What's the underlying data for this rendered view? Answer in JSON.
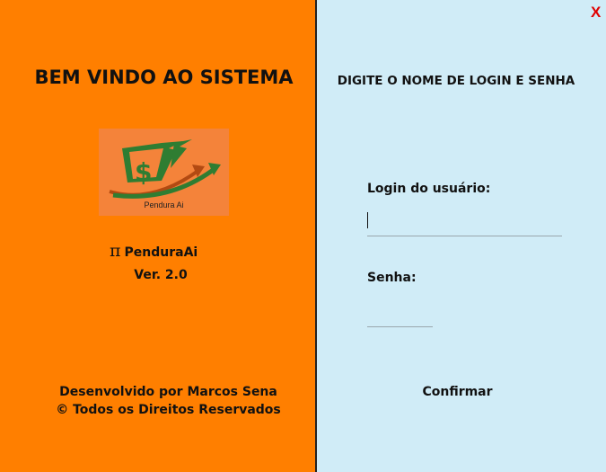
{
  "left_panel": {
    "welcome_title": "BEM VINDO AO SISTEMA",
    "logo_caption": "Pendura Ai",
    "pi_symbol": "π",
    "app_name": "PenduraAi",
    "version": "Ver. 2.0",
    "credits_line1": "Desenvolvido por Marcos Sena",
    "credits_line2": "© Todos os Direitos Reservados",
    "background_color": "#ff7f00"
  },
  "right_panel": {
    "close_label": "X",
    "instruction": "DIGITE O NOME DE LOGIN E SENHA",
    "username_label": "Login do usuário:",
    "username_value": "",
    "password_label": "Senha:",
    "password_value": "",
    "confirm_label": "Confirmar",
    "background_color": "#d0ecf7"
  }
}
